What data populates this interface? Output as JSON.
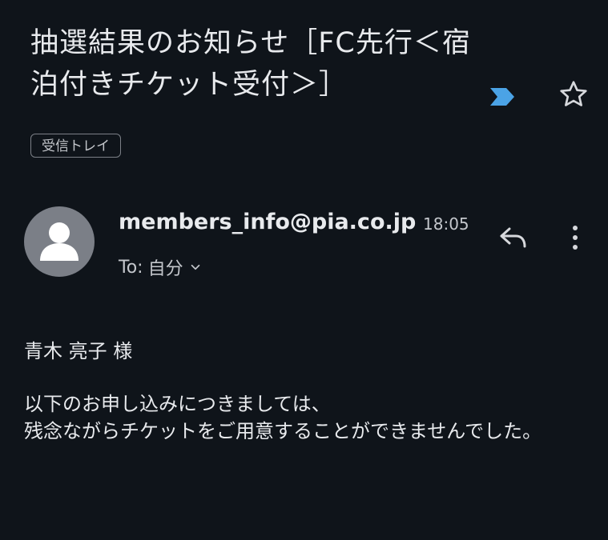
{
  "email": {
    "subject": "抽選結果のお知らせ［FC先行＜宿泊付きチケット受付＞］",
    "label": "受信トレイ",
    "sender": "members_info@pia.co.jp",
    "time": "18:05",
    "to_prefix": "To:",
    "to_recipient": "自分",
    "body": {
      "salutation": "青木 亮子 様",
      "line1": "以下のお申し込みにつきましては、",
      "line2": "残念ながらチケットをご用意することができませんでした。"
    }
  },
  "icons": {
    "importance": "importance-marker-icon",
    "star": "star-outline-icon",
    "avatar": "person-avatar-icon",
    "reply": "reply-icon",
    "more": "more-vert-icon",
    "expand": "chevron-down-icon"
  },
  "colors": {
    "background": "#0f141a",
    "importance": "#4ba3e6",
    "avatar_bg": "#7b7f87"
  }
}
